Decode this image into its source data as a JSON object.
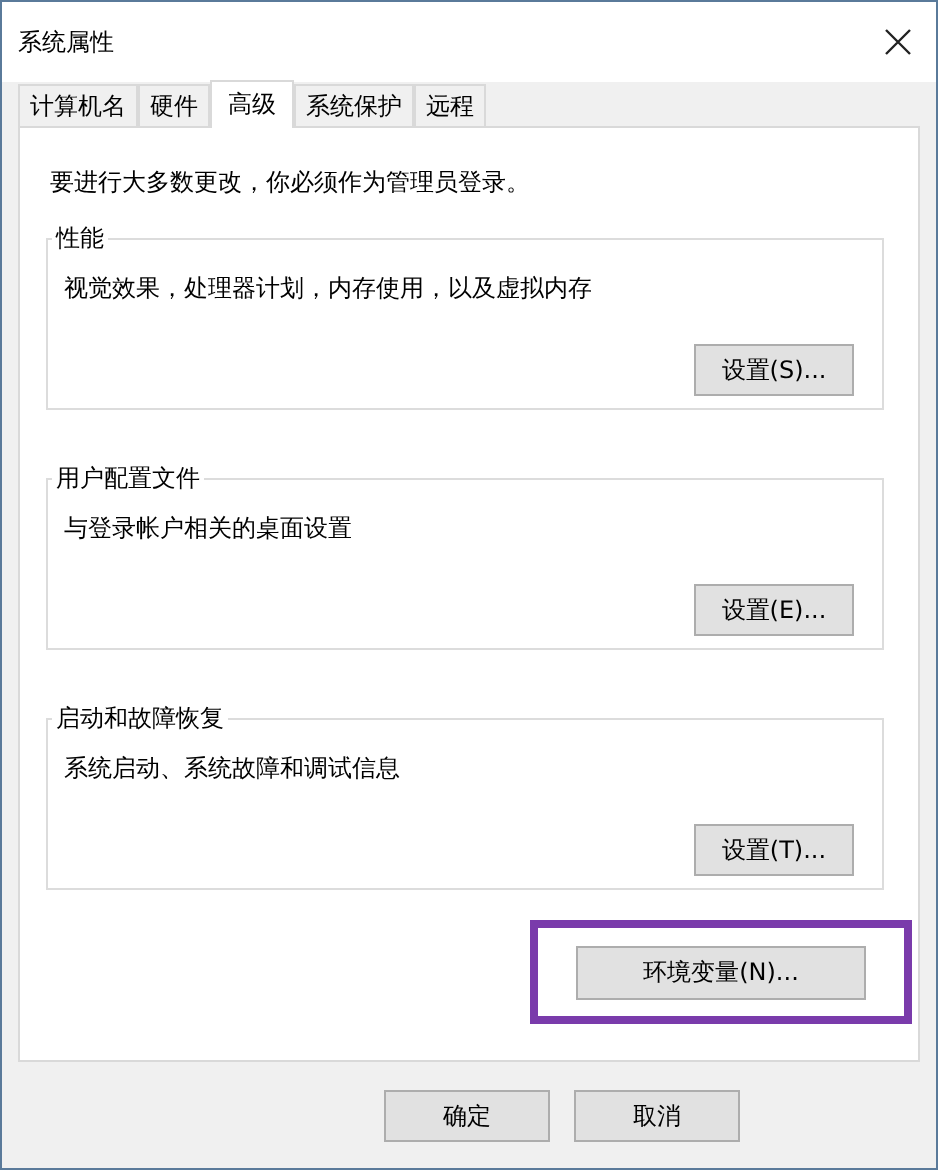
{
  "window": {
    "title": "系统属性"
  },
  "tabs": [
    {
      "label": "计算机名",
      "selected": false
    },
    {
      "label": "硬件",
      "selected": false
    },
    {
      "label": "高级",
      "selected": true
    },
    {
      "label": "系统保护",
      "selected": false
    },
    {
      "label": "远程",
      "selected": false
    }
  ],
  "notice": "要进行大多数更改，你必须作为管理员登录。",
  "groups": [
    {
      "title": "性能",
      "description": "视觉效果，处理器计划，内存使用，以及虚拟内存",
      "button": "设置(S)..."
    },
    {
      "title": "用户配置文件",
      "description": "与登录帐户相关的桌面设置",
      "button": "设置(E)..."
    },
    {
      "title": "启动和故障恢复",
      "description": "系统启动、系统故障和调试信息",
      "button": "设置(T)..."
    }
  ],
  "environment_button": {
    "label": "环境变量(N)...",
    "highlighted": true
  },
  "buttons": [
    "确定",
    "取消"
  ]
}
